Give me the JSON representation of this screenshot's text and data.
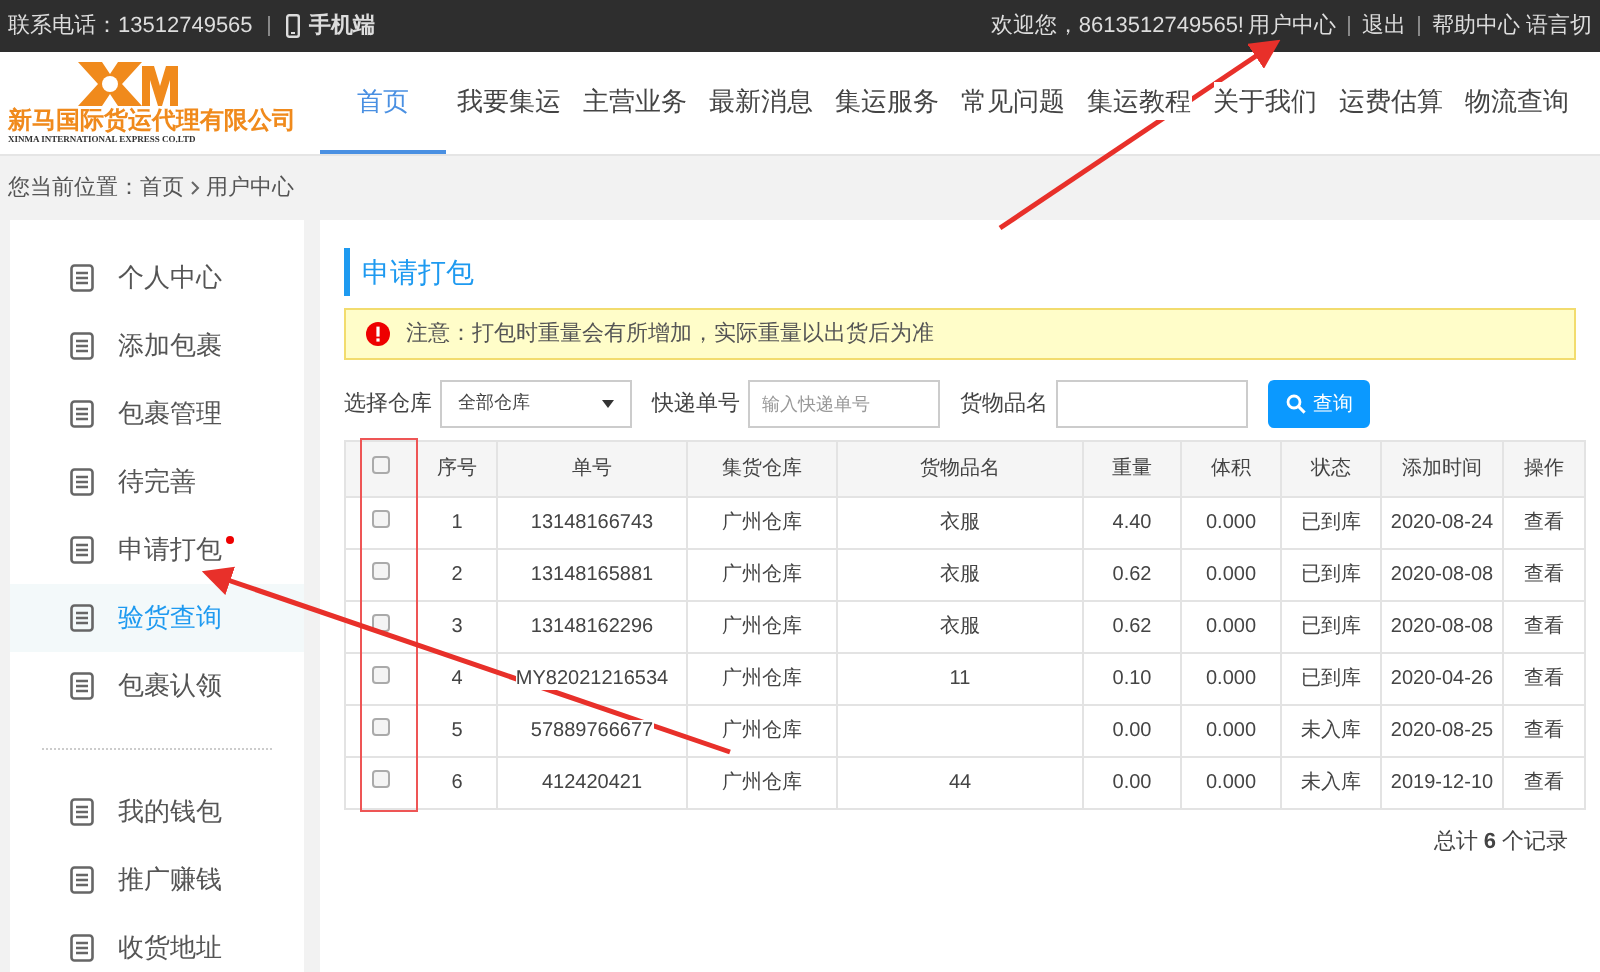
{
  "top_bar": {
    "phone": "联系电话：13512749565",
    "mobile": "手机端",
    "welcome": "欢迎您，8613512749565!",
    "links": [
      "用户中心",
      "退出",
      "帮助中心"
    ],
    "language": "语言切"
  },
  "logo": {
    "name": "新马国际货运代理有限公司",
    "english": "XINMA INTERNATIONAL EXPRESS CO.LTD"
  },
  "nav": [
    {
      "label": "首页",
      "selected": true
    },
    {
      "label": "我要集运",
      "selected": false
    },
    {
      "label": "主营业务",
      "selected": false
    },
    {
      "label": "最新消息",
      "selected": false
    },
    {
      "label": "集运服务",
      "selected": false
    },
    {
      "label": "常见问题",
      "selected": false
    },
    {
      "label": "集运教程",
      "selected": false
    },
    {
      "label": "关于我们",
      "selected": false
    },
    {
      "label": "运费估算",
      "selected": false
    },
    {
      "label": "物流查询",
      "selected": false
    }
  ],
  "breadcrumb": {
    "prefix": "您当前位置：",
    "items": [
      "首页",
      "用户中心"
    ]
  },
  "sidebar": {
    "groups": [
      [
        {
          "label": "个人中心",
          "selected": false,
          "dot": false
        },
        {
          "label": "添加包裹",
          "selected": false,
          "dot": false
        },
        {
          "label": "包裹管理",
          "selected": false,
          "dot": false
        },
        {
          "label": "待完善",
          "selected": false,
          "dot": false
        },
        {
          "label": "申请打包",
          "selected": false,
          "dot": true
        },
        {
          "label": "验货查询",
          "selected": true,
          "dot": false
        },
        {
          "label": "包裹认领",
          "selected": false,
          "dot": false
        }
      ],
      [
        {
          "label": "我的钱包",
          "selected": false,
          "dot": false
        },
        {
          "label": "推广赚钱",
          "selected": false,
          "dot": false
        },
        {
          "label": "收货地址",
          "selected": false,
          "dot": false
        }
      ]
    ]
  },
  "panel": {
    "title": "申请打包",
    "notice": "注意：打包时重量会有所增加，实际重量以出货后为准",
    "filters": {
      "warehouse_label": "选择仓库",
      "warehouse_value": "全部仓库",
      "tracking_label": "快递单号",
      "tracking_placeholder": "输入快递单号",
      "goods_label": "货物品名",
      "search_button": "查询"
    },
    "table": {
      "select_all_checked": false,
      "columns": [
        "序号",
        "单号",
        "集货仓库",
        "货物品名",
        "重量",
        "体积",
        "状态",
        "添加时间",
        "操作"
      ],
      "rows": [
        {
          "checked": false,
          "cells": [
            "1",
            "13148166743",
            "广州仓库",
            "衣服",
            "4.40",
            "0.000",
            "已到库",
            "2020-08-24",
            "查看"
          ]
        },
        {
          "checked": false,
          "cells": [
            "2",
            "13148165881",
            "广州仓库",
            "衣服",
            "0.62",
            "0.000",
            "已到库",
            "2020-08-08",
            "查看"
          ]
        },
        {
          "checked": false,
          "cells": [
            "3",
            "13148162296",
            "广州仓库",
            "衣服",
            "0.62",
            "0.000",
            "已到库",
            "2020-08-08",
            "查看"
          ]
        },
        {
          "checked": false,
          "cells": [
            "4",
            "MY82021216534",
            "广州仓库",
            "11",
            "0.10",
            "0.000",
            "已到库",
            "2020-04-26",
            "查看"
          ]
        },
        {
          "checked": false,
          "cells": [
            "5",
            "57889766677",
            "广州仓库",
            "",
            "0.00",
            "0.000",
            "未入库",
            "2020-08-25",
            "查看"
          ]
        },
        {
          "checked": false,
          "cells": [
            "6",
            "412420421",
            "广州仓库",
            "44",
            "0.00",
            "0.000",
            "未入库",
            "2019-12-10",
            "查看"
          ]
        }
      ]
    },
    "total": "总计 **6** 个记录"
  }
}
